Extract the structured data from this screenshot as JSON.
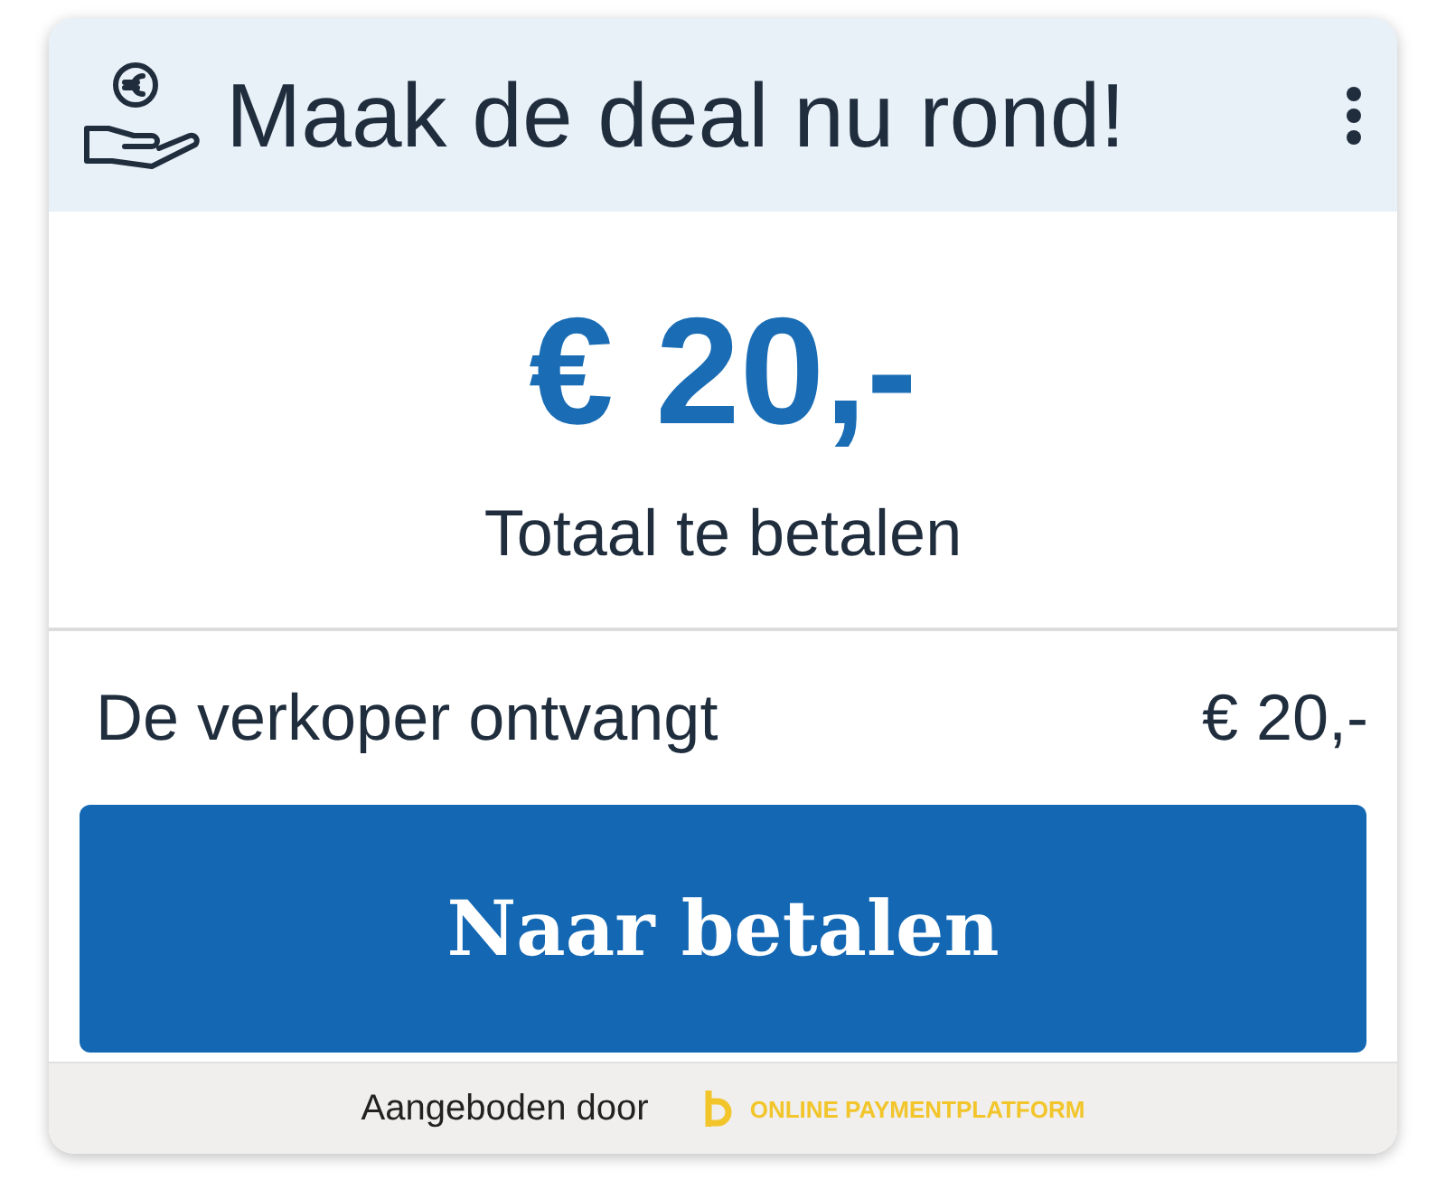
{
  "header": {
    "title": "Maak de deal nu rond!"
  },
  "total": {
    "amount": "€ 20,-",
    "label": "Totaal te betalen"
  },
  "seller_row": {
    "label": "De verkoper ontvangt",
    "value": "€ 20,-"
  },
  "pay_button": {
    "label": "Naar betalen"
  },
  "footer": {
    "offered_by": "Aangeboden door",
    "provider": "ONLINE PAYMENTPLATFORM"
  }
}
